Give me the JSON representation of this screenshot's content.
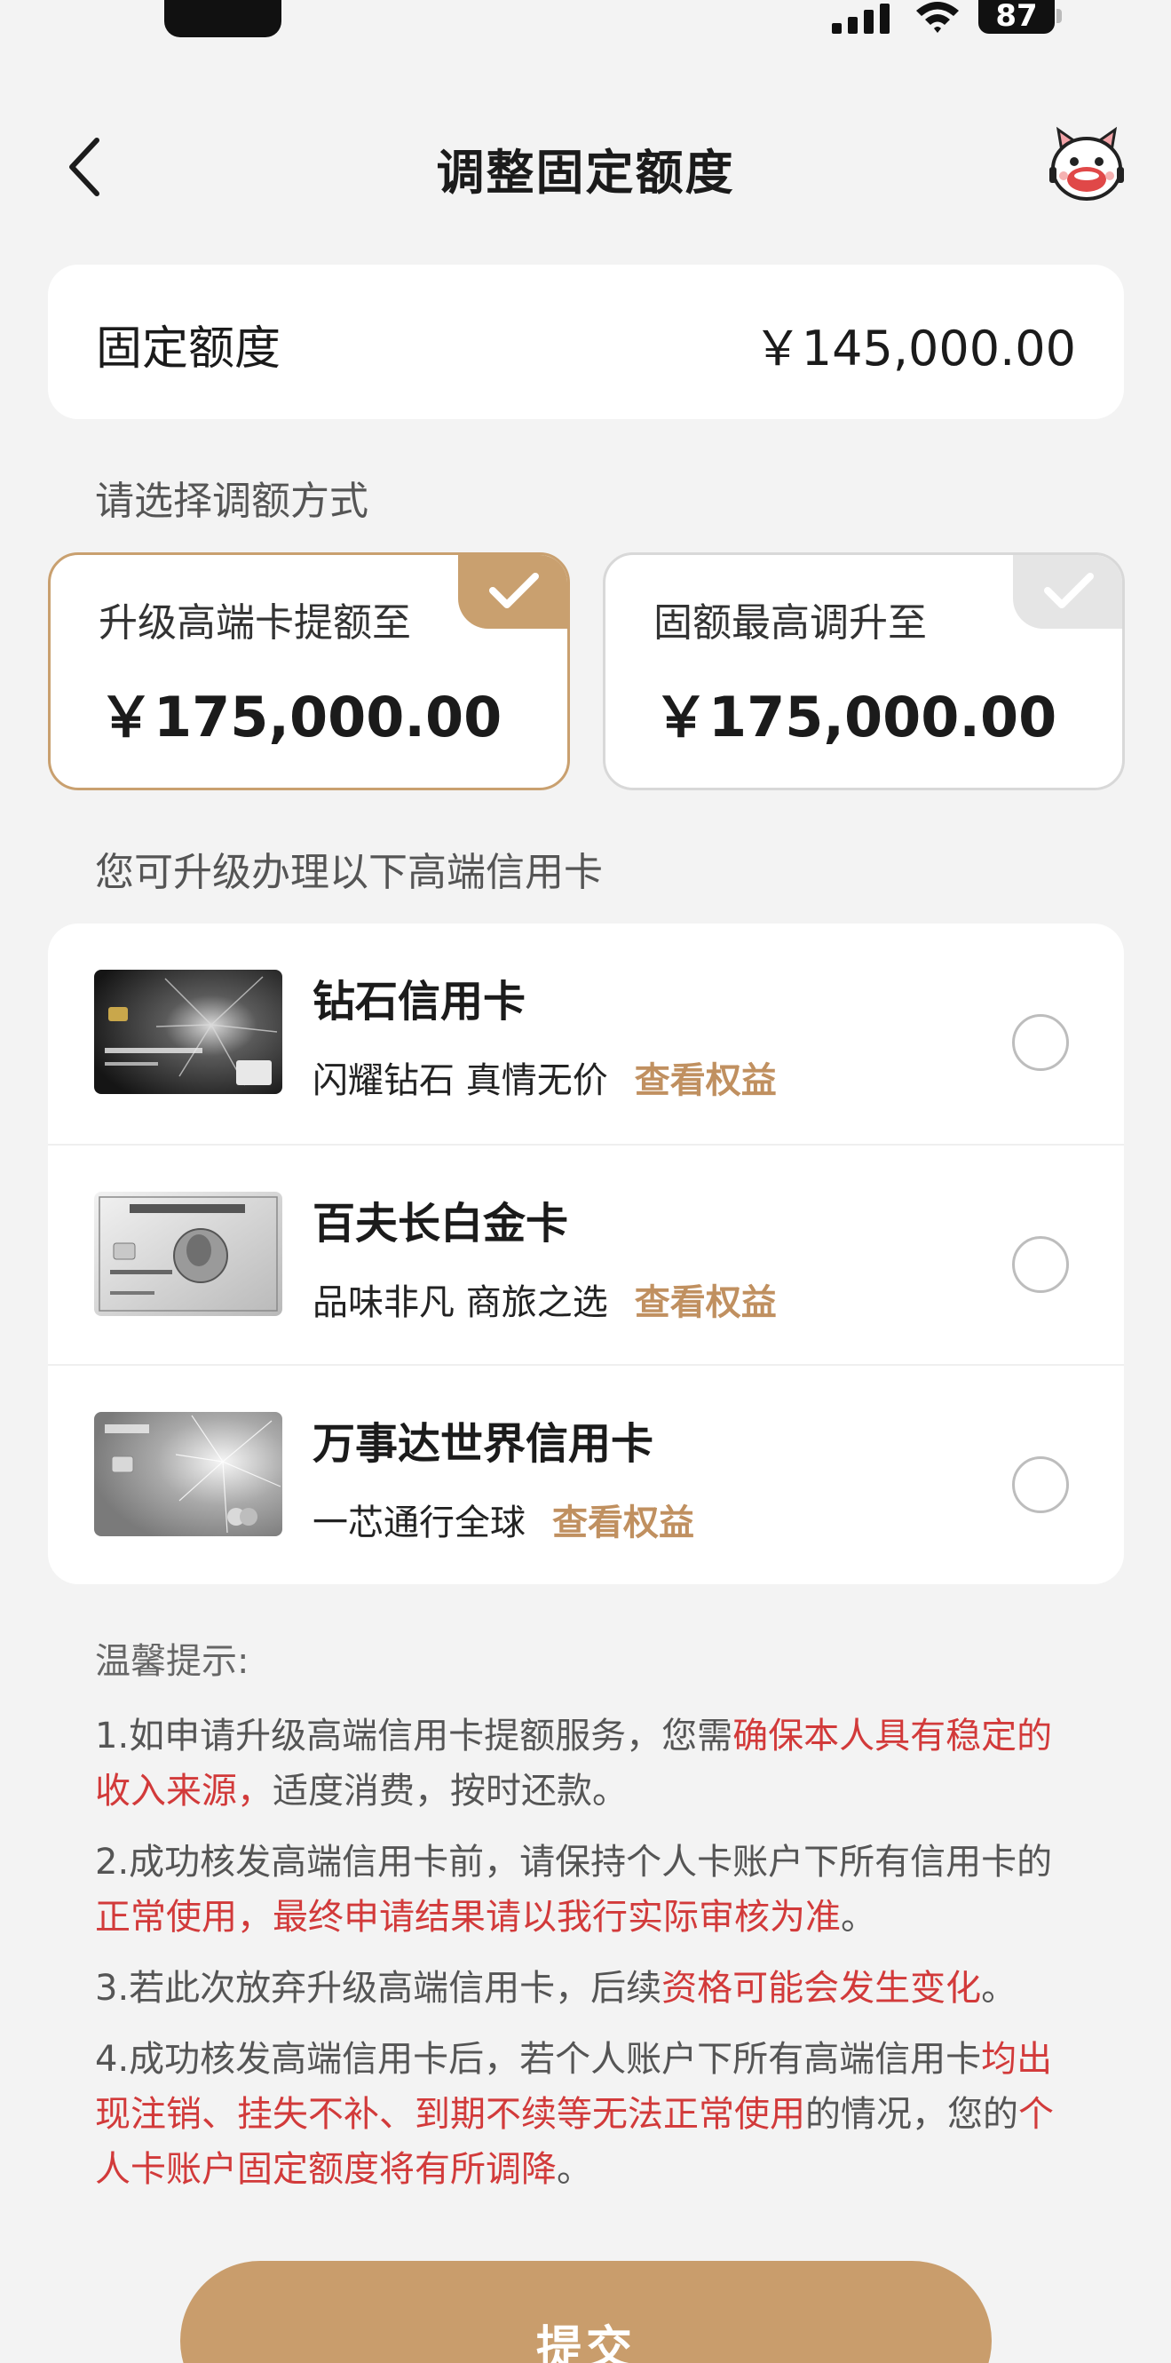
{
  "status_bar": {
    "battery": "87",
    "icons": [
      "signal-icon",
      "wifi-icon",
      "battery-icon"
    ]
  },
  "nav": {
    "title": "调整固定额度",
    "back_icon": "chevron-left-icon",
    "mascot_icon": "mascot-icon"
  },
  "quota": {
    "label": "固定额度",
    "value": "￥145,000.00"
  },
  "choose_label": "请选择调额方式",
  "options": [
    {
      "title": "升级高端卡提额至",
      "amount": "￥175,000.00",
      "selected": true
    },
    {
      "title": "固额最高调升至",
      "amount": "￥175,000.00",
      "selected": false
    }
  ],
  "cards_label": "您可升级办理以下高端信用卡",
  "cards": [
    {
      "name": "钻石信用卡",
      "desc": "闪耀钻石 真情无价",
      "link": "查看权益"
    },
    {
      "name": "百夫长白金卡",
      "desc": "品味非凡 商旅之选",
      "link": "查看权益"
    },
    {
      "name": "万事达世界信用卡",
      "desc": "一芯通行全球",
      "link": "查看权益"
    }
  ],
  "tips": {
    "title": "温馨提示:",
    "items": [
      {
        "p1": "1.如申请升级高端信用卡提额服务，您需",
        "h1": "确保本人具有稳定的收入来源，",
        "p2": "适度消费，按时还款。",
        "h2": "",
        "p3": ""
      },
      {
        "p1": "2.成功核发高端信用卡前，请保持个人卡账户下所有信用卡的",
        "h1": "正常使用，最终申请结果请以我行实际审核为准",
        "p2": "。",
        "h2": "",
        "p3": ""
      },
      {
        "p1": "3.若此次放弃升级高端信用卡，后续",
        "h1": "资格可能会发生变化",
        "p2": "。",
        "h2": "",
        "p3": ""
      },
      {
        "p1": "4.成功核发高端信用卡后，若个人账户下所有高端信用卡",
        "h1": "均出现注销、挂失不补、到期不续等无法正常使用",
        "p2": "的情况，您的",
        "h2": "个人卡账户固定额度将有所调降",
        "p3": "。"
      }
    ]
  },
  "submit_label": "提交",
  "colors": {
    "accent": "#c99d6c",
    "highlight": "#d23a3a",
    "background": "#f3f3f3"
  }
}
